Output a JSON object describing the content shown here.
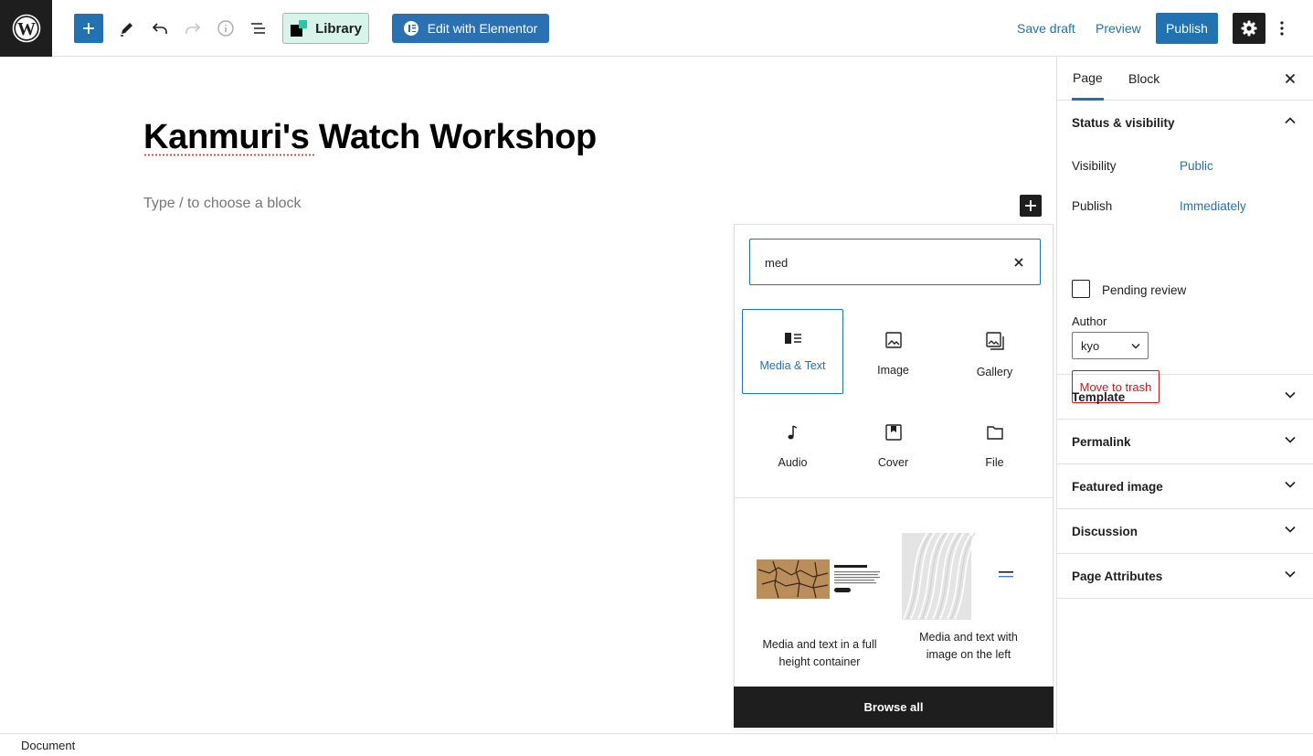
{
  "toolbar": {
    "library_label": "Library",
    "elementor_label": "Edit with Elementor",
    "save_draft_label": "Save draft",
    "preview_label": "Preview",
    "publish_label": "Publish",
    "accent_color": "#2271b1"
  },
  "editor": {
    "post_title": "Kanmuri's Watch Workshop",
    "block_placeholder": "Type / to choose a block"
  },
  "inserter": {
    "search_value": "med",
    "blocks": [
      {
        "label": "Media & Text",
        "icon": "media-text-icon",
        "selected": true
      },
      {
        "label": "Image",
        "icon": "image-icon",
        "selected": false
      },
      {
        "label": "Gallery",
        "icon": "gallery-icon",
        "selected": false
      },
      {
        "label": "Audio",
        "icon": "audio-icon",
        "selected": false
      },
      {
        "label": "Cover",
        "icon": "cover-icon",
        "selected": false
      },
      {
        "label": "File",
        "icon": "file-icon",
        "selected": false
      }
    ],
    "patterns": [
      {
        "label_line1": "Media and text in a full",
        "label_line2": "height container",
        "preview_heading": "What's the problem?",
        "preview_button": "Learn more"
      },
      {
        "label_line1": "Media and text with",
        "label_line2": "image on the left",
        "preview_heading": "Opén Abstract",
        "preview_link": "Read more"
      }
    ],
    "browse_all_label": "Browse all"
  },
  "sidebar": {
    "tabs": [
      "Page",
      "Block"
    ],
    "active_tab": "Page",
    "status_title": "Status & visibility",
    "visibility_label": "Visibility",
    "visibility_value": "Public",
    "publish_label": "Publish",
    "publish_value": "Immediately",
    "pending_review_label": "Pending review",
    "author_label": "Author",
    "author_value": "kyo",
    "trash_label": "Move to trash",
    "panels": [
      "Template",
      "Permalink",
      "Featured image",
      "Discussion",
      "Page Attributes"
    ]
  },
  "footer": {
    "breadcrumb": "Document"
  }
}
